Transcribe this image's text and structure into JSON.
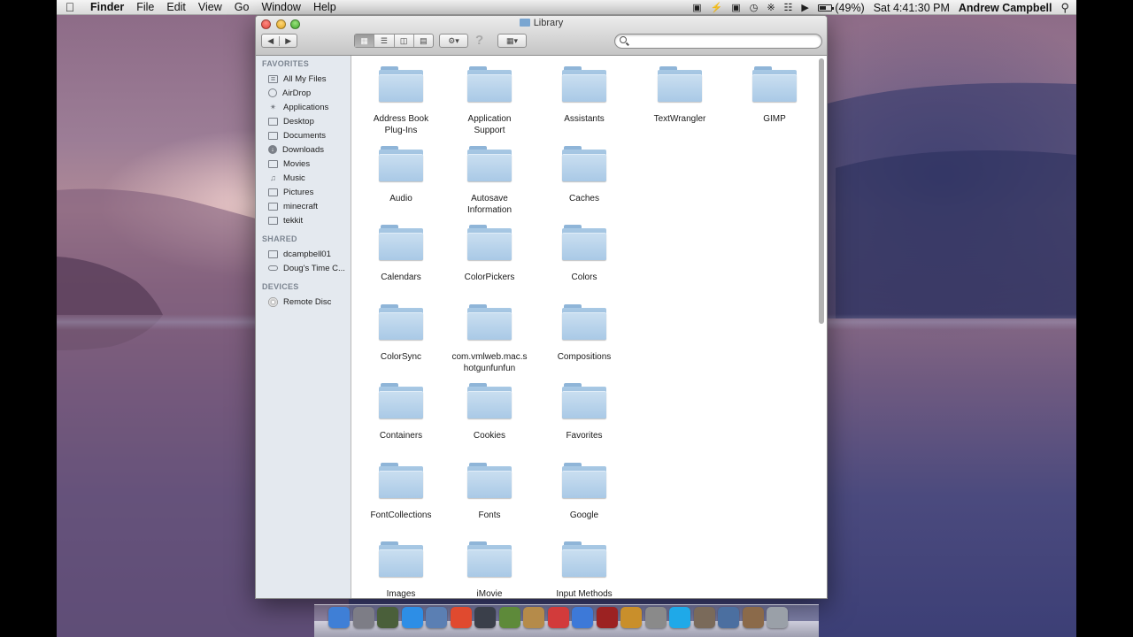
{
  "menubar": {
    "app_name": "Finder",
    "menus": [
      "File",
      "Edit",
      "View",
      "Go",
      "Window",
      "Help"
    ],
    "battery": "(49%)",
    "battery_level": 0.49,
    "clock": "Sat 4:41:30 PM",
    "user": "Andrew Campbell"
  },
  "window": {
    "title": "Library",
    "search": {
      "value": "",
      "placeholder": ""
    }
  },
  "sidebar": {
    "favorites_header": "FAVORITES",
    "favorites": [
      {
        "label": "All My Files",
        "icon": "all-files-icon"
      },
      {
        "label": "AirDrop",
        "icon": "airdrop-icon"
      },
      {
        "label": "Applications",
        "icon": "applications-icon"
      },
      {
        "label": "Desktop",
        "icon": "desktop-icon"
      },
      {
        "label": "Documents",
        "icon": "documents-icon"
      },
      {
        "label": "Downloads",
        "icon": "downloads-icon"
      },
      {
        "label": "Movies",
        "icon": "movies-icon"
      },
      {
        "label": "Music",
        "icon": "music-icon"
      },
      {
        "label": "Pictures",
        "icon": "pictures-icon"
      },
      {
        "label": "minecraft",
        "icon": "folder-icon"
      },
      {
        "label": "tekkit",
        "icon": "folder-icon"
      }
    ],
    "shared_header": "SHARED",
    "shared": [
      {
        "label": "dcampbell01",
        "icon": "computer-icon"
      },
      {
        "label": "Doug's Time C...",
        "icon": "time-capsule-icon"
      }
    ],
    "devices_header": "DEVICES",
    "devices": [
      {
        "label": "Remote Disc",
        "icon": "disc-icon"
      }
    ]
  },
  "folders": {
    "row1": [
      {
        "label": "Address Book\nPlug-Ins"
      },
      {
        "label": "Application\nSupport"
      },
      {
        "label": "Assistants"
      },
      {
        "label": "TextWrangler"
      },
      {
        "label": "GIMP"
      }
    ],
    "row2": [
      {
        "label": "Audio"
      },
      {
        "label": "Autosave\nInformation"
      },
      {
        "label": "Caches"
      }
    ],
    "row3": [
      {
        "label": "Calendars"
      },
      {
        "label": "ColorPickers"
      },
      {
        "label": "Colors"
      }
    ],
    "row4": [
      {
        "label": "ColorSync"
      },
      {
        "label": "com.vmlweb.mac.s\nhotgunfunfun"
      },
      {
        "label": "Compositions"
      }
    ],
    "row5": [
      {
        "label": "Containers"
      },
      {
        "label": "Cookies"
      },
      {
        "label": "Favorites"
      }
    ],
    "row6": [
      {
        "label": "FontCollections"
      },
      {
        "label": "Fonts"
      },
      {
        "label": "Google"
      }
    ],
    "row7": [
      {
        "label": "Images"
      },
      {
        "label": "iMovie"
      },
      {
        "label": "Input Methods"
      }
    ]
  },
  "dock": {
    "apps": [
      {
        "icon": "finder-icon",
        "color": "#3f7fd6"
      },
      {
        "icon": "launchpad-icon",
        "color": "#7d7d86"
      },
      {
        "icon": "mission-control-icon",
        "color": "#4a5f3a"
      },
      {
        "icon": "app-store-icon",
        "color": "#2d8ee6"
      },
      {
        "icon": "preview-icon",
        "color": "#5b7fb3"
      },
      {
        "icon": "chrome-icon",
        "color": "#e04a2f"
      },
      {
        "icon": "facetime-icon",
        "color": "#3a3f4a"
      },
      {
        "icon": "minecraft-icon",
        "color": "#5e8a3a"
      },
      {
        "icon": "contacts-icon",
        "color": "#b58b4a"
      },
      {
        "icon": "calendar-icon",
        "color": "#d23b3b"
      },
      {
        "icon": "itunes-icon",
        "color": "#3d79d8"
      },
      {
        "icon": "photo-booth-icon",
        "color": "#9c2222"
      },
      {
        "icon": "iphoto-icon",
        "color": "#c98f2b"
      },
      {
        "icon": "system-preferences-icon",
        "color": "#8a8a8a"
      },
      {
        "icon": "skype-icon",
        "color": "#1fa9e8"
      },
      {
        "icon": "utilities-icon",
        "color": "#7a6a5a"
      },
      {
        "icon": "network-icon",
        "color": "#4b6fa0"
      },
      {
        "icon": "tools-icon",
        "color": "#8b6a4a"
      },
      {
        "icon": "trash-icon",
        "color": "#9aa0a8"
      }
    ]
  }
}
